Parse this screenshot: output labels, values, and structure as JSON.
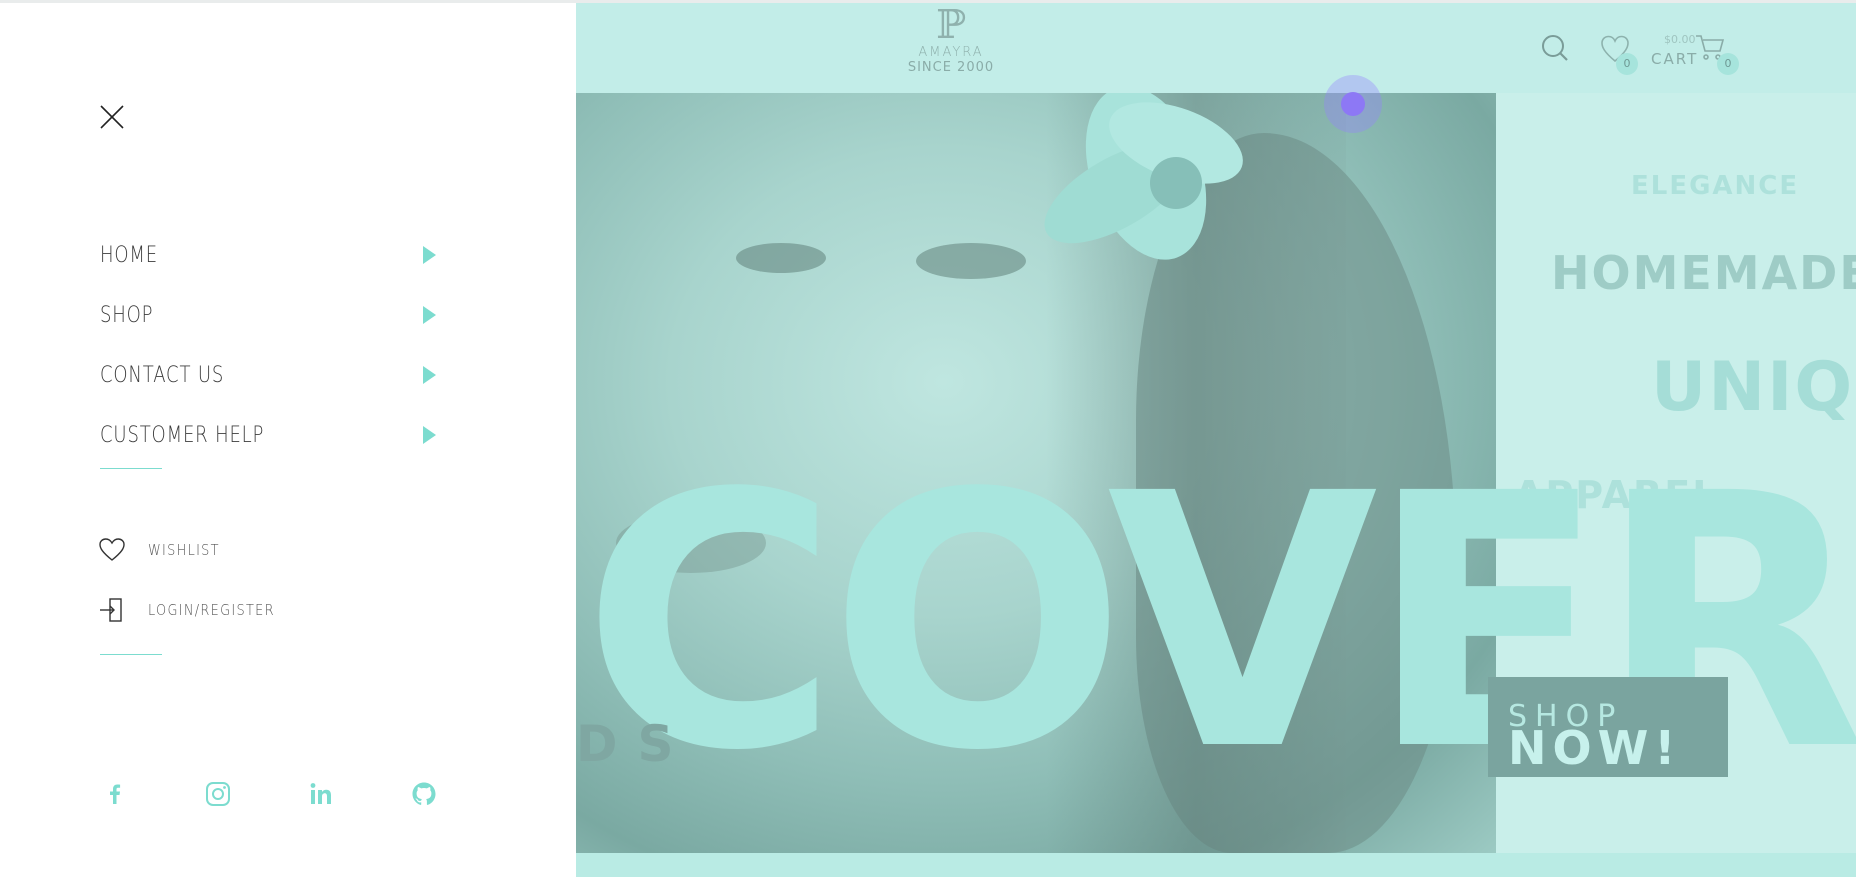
{
  "drawer": {
    "menu": [
      {
        "label": "HOME"
      },
      {
        "label": "SHOP"
      },
      {
        "label": "CONTACT US"
      },
      {
        "label": "CUSTOMER HELP"
      }
    ],
    "wishlist_label": "WISHLIST",
    "login_label": "LOGIN/REGISTER",
    "socials": [
      "facebook-icon",
      "instagram-icon",
      "linkedin-icon",
      "github-icon"
    ]
  },
  "header": {
    "logo_name": "AMAYRA",
    "logo_since": "SINCE 2000",
    "wishlist_count": "0",
    "cart_price": "$0.00",
    "cart_label": "CART",
    "cart_count": "0"
  },
  "hero": {
    "words": [
      "ELEGANCE",
      "HOMEMADE",
      "UNIQUE",
      "APPAREL"
    ],
    "big_text": "COVER",
    "side_text": "DS",
    "cta_line1": "SHOP",
    "cta_line2": "NOW!"
  },
  "colors": {
    "accent": "#7cdccf",
    "overlay": "#c2ede8",
    "cta_bg": "#7aa49f"
  }
}
